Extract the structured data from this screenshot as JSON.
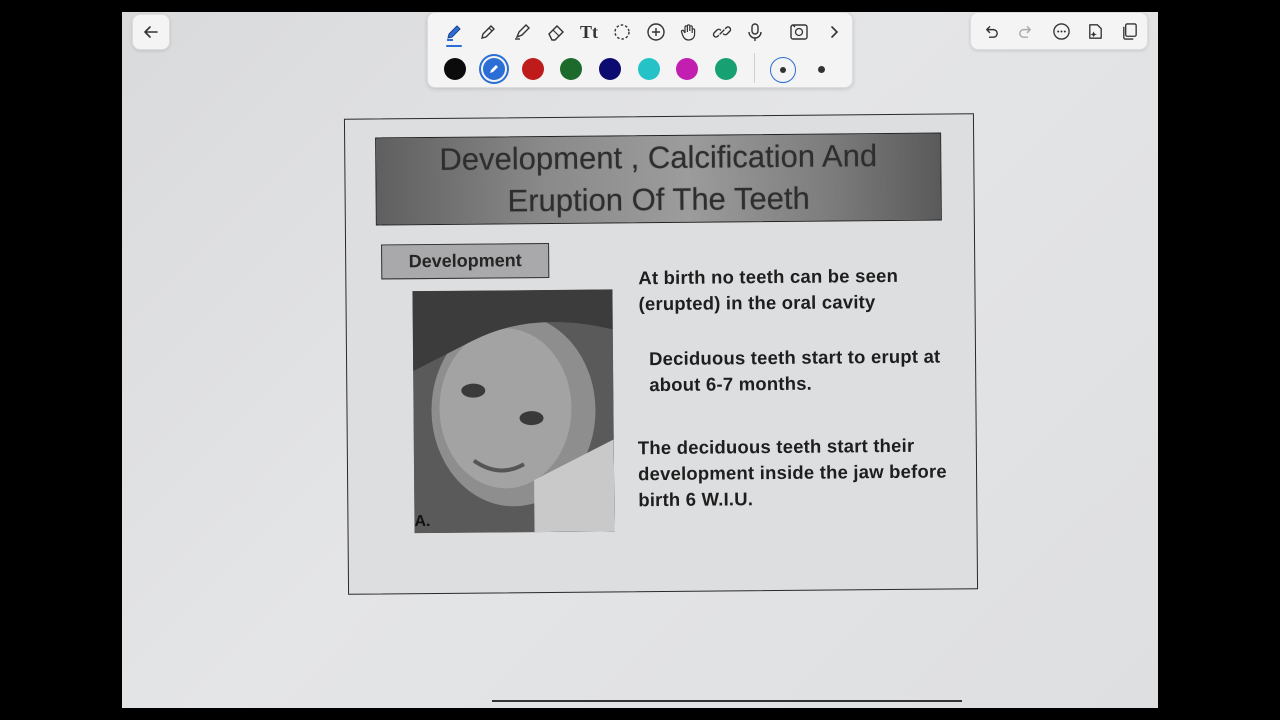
{
  "toolbar": {
    "tools": [
      {
        "name": "pen-tool-icon",
        "active": true
      },
      {
        "name": "pencil-tool-icon"
      },
      {
        "name": "highlighter-tool-icon"
      },
      {
        "name": "eraser-tool-icon"
      },
      {
        "name": "text-tool-icon",
        "label": "Tt"
      },
      {
        "name": "lasso-tool-icon"
      },
      {
        "name": "add-shape-icon"
      },
      {
        "name": "hand-tool-icon"
      },
      {
        "name": "link-tool-icon"
      },
      {
        "name": "microphone-icon"
      },
      {
        "name": "screenshot-icon"
      },
      {
        "name": "chevron-right-icon"
      }
    ],
    "colors": [
      "#0b0b0b",
      "#2b6fd6",
      "#c01b1b",
      "#1c6b2c",
      "#0b0b70",
      "#25c3c8",
      "#c21fb0",
      "#17a173"
    ],
    "selected_color": "#2b6fd6"
  },
  "right_bar": {
    "tools": [
      "undo-icon",
      "redo-icon",
      "more-icon",
      "ai-assist-icon",
      "pages-icon"
    ]
  },
  "slide": {
    "title": "Development , Calcification And Eruption Of The Teeth",
    "section": "Development",
    "photo_label": "A.",
    "paragraphs": [
      "At birth no teeth can be seen (erupted) in the oral cavity",
      "Deciduous teeth start to erupt at about 6-7 months.",
      "The deciduous teeth start their development inside the jaw before birth 6 W.I.U."
    ]
  }
}
